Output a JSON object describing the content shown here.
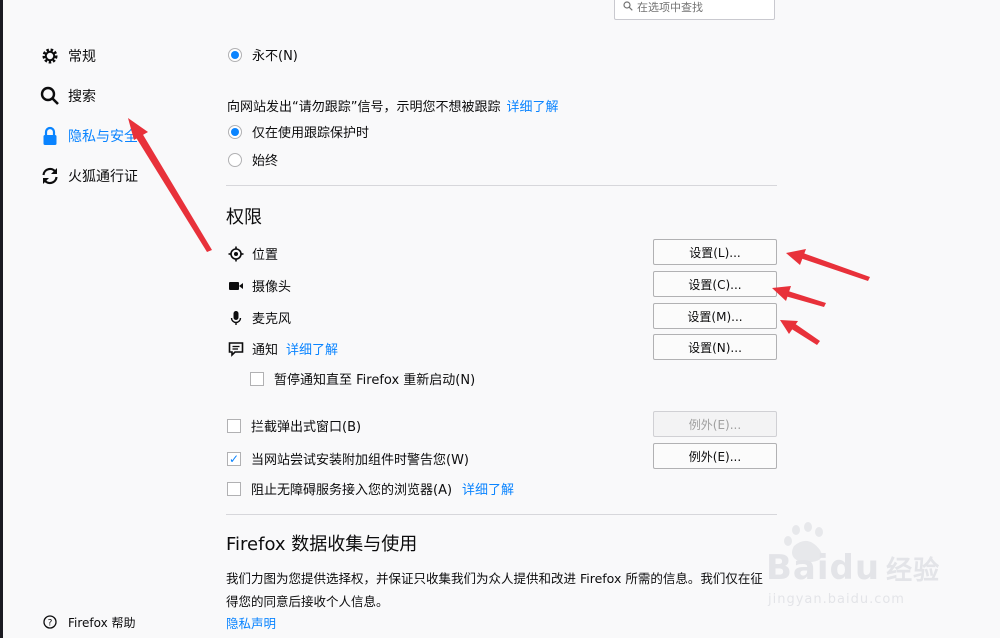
{
  "search": {
    "placeholder": "在选项中查找",
    "icon": "search-icon"
  },
  "sidebar": {
    "items": [
      {
        "label": "常规",
        "icon": "gear-icon",
        "selected": false
      },
      {
        "label": "搜索",
        "icon": "search-icon",
        "selected": false
      },
      {
        "label": "隐私与安全",
        "icon": "lock-icon",
        "selected": true
      },
      {
        "label": "火狐通行证",
        "icon": "sync-icon",
        "selected": false
      }
    ],
    "help": {
      "label": "Firefox 帮助",
      "icon": "help-icon"
    }
  },
  "history": {
    "never_option": "永不(N)"
  },
  "dnt": {
    "description": "向网站发出“请勿跟踪”信号，示明您不想被跟踪",
    "learn_more": "详细了解",
    "options": [
      {
        "label": "仅在使用跟踪保护时",
        "checked": true
      },
      {
        "label": "始终",
        "checked": false
      }
    ]
  },
  "permissions": {
    "title": "权限",
    "items": [
      {
        "label": "位置",
        "icon": "location-icon",
        "button": "设置(L)..."
      },
      {
        "label": "摄像头",
        "icon": "camera-icon",
        "button": "设置(C)..."
      },
      {
        "label": "麦克风",
        "icon": "microphone-icon",
        "button": "设置(M)..."
      },
      {
        "label": "通知",
        "icon": "notification-icon",
        "button": "设置(N)...",
        "learn_more": "详细了解"
      }
    ],
    "pause_notifications": {
      "label": "暂停通知直至 Firefox 重新启动(N)",
      "checked": false
    },
    "block_popups": {
      "label": "拦截弹出式窗口(B)",
      "checked": false,
      "button": "例外(E)...",
      "button_disabled": true
    },
    "warn_addons": {
      "label": "当网站尝试安装附加组件时警告您(W)",
      "checked": true,
      "button": "例外(E)..."
    },
    "block_accessibility": {
      "label": "阻止无障碍服务接入您的浏览器(A)",
      "checked": false,
      "learn_more": "详细了解"
    }
  },
  "data_collection": {
    "title": "Firefox 数据收集与使用",
    "description_line1": "我们力图为您提供选择权，并保证只收集我们为众人提供和改进 Firefox 所需的信息。我们仅在征",
    "description_line2": "得您的同意后接收个人信息。",
    "privacy_link": "隐私声明"
  },
  "watermark": {
    "brand": "Bai",
    "suffix": "du",
    "product": "经验",
    "url": "jingyan.baidu.com"
  },
  "colors": {
    "accent": "#0a84ff",
    "annotation_arrow": "#e8313a"
  }
}
